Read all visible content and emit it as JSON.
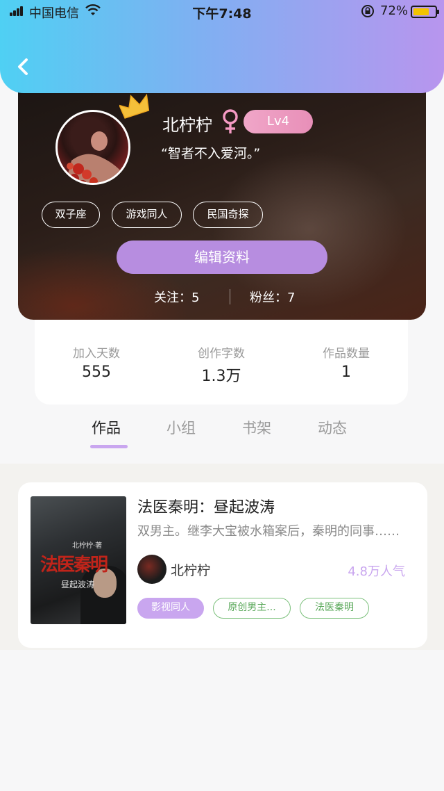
{
  "status_bar": {
    "carrier": "中国电信",
    "time": "下午7:48",
    "battery_percent": "72%",
    "battery_level": 0.72
  },
  "profile": {
    "username": "北柠柠",
    "gender": "female",
    "level": "Lv4",
    "signature": "“智者不入爱河。”",
    "tags": [
      "双子座",
      "游戏同人",
      "民国奇探"
    ],
    "edit_label": "编辑资料",
    "following_label": "关注：5",
    "followers_label": "粉丝：7"
  },
  "stats": [
    {
      "label": "加入天数",
      "value": "555"
    },
    {
      "label": "创作字数",
      "value": "1.3万"
    },
    {
      "label": "作品数量",
      "value": "1"
    }
  ],
  "tabs": [
    "作品",
    "小组",
    "书架",
    "动态"
  ],
  "active_tab": "作品",
  "work": {
    "title": "法医秦明：昼起波涛",
    "description": "双男主。继李大宝被水箱案后，秦明的同事……",
    "author": "北柠柠",
    "popularity": "4.8万人气",
    "tags": [
      "影视同人",
      "原创男主...",
      "法医秦明"
    ],
    "cover_title": "法医秦明",
    "cover_subtitle": "昼起波涛",
    "cover_author": "北柠柠·著"
  },
  "colors": {
    "header_gradient_start": "#4fd0f3",
    "header_gradient_end": "#b895ee",
    "accent_purple": "#b78de0",
    "tag_green": "#7cc07c",
    "level_pink": "#f0a6c8"
  }
}
